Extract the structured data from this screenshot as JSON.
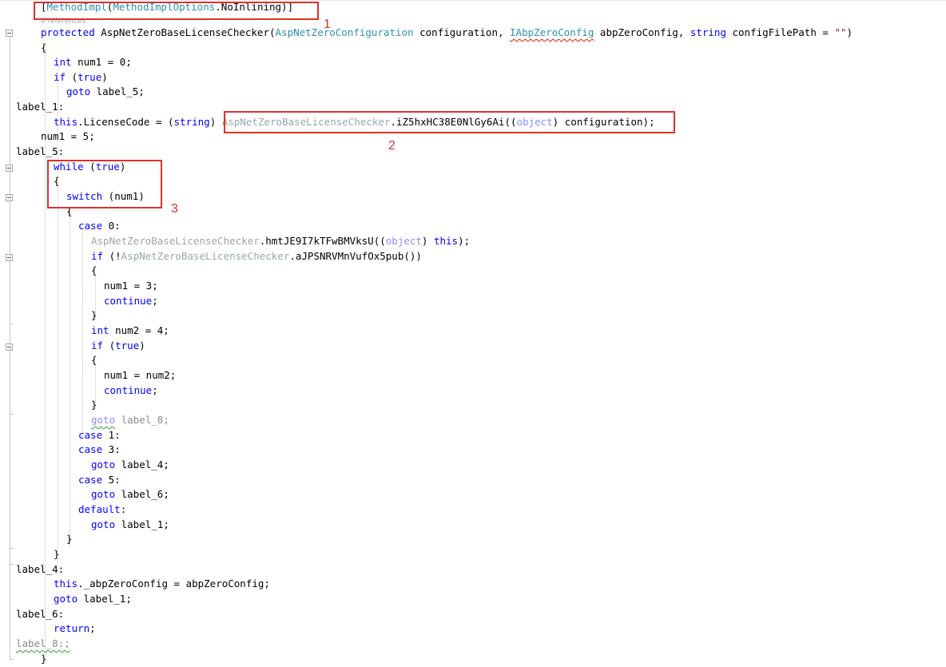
{
  "codelens": "0 references",
  "lines": [
    {
      "tokens": [
        {
          "t": "[",
          "c": ""
        },
        {
          "t": "MethodImpl",
          "c": "ty"
        },
        {
          "t": "(",
          "c": ""
        },
        {
          "t": "MethodImplOptions",
          "c": "ty"
        },
        {
          "t": ".NoInlining)]",
          "c": ""
        }
      ]
    },
    {
      "tokens": [
        {
          "t": "protected ",
          "c": "kw"
        },
        {
          "t": "AspNetZeroBaseLicenseChecker(",
          "c": ""
        },
        {
          "t": "AspNetZeroConfiguration",
          "c": "ty"
        },
        {
          "t": " configuration, ",
          "c": ""
        },
        {
          "t": "IAbpZeroConfig",
          "c": "ty squig sq-red"
        },
        {
          "t": " abpZeroConfig, ",
          "c": ""
        },
        {
          "t": "string",
          "c": "kw"
        },
        {
          "t": " configFilePath = ",
          "c": ""
        },
        {
          "t": "\"\"",
          "c": "str"
        },
        {
          "t": ")",
          "c": ""
        }
      ]
    },
    {
      "tokens": [
        {
          "t": "{",
          "c": ""
        }
      ]
    },
    {
      "tokens": [
        {
          "t": "int",
          "c": "kw"
        },
        {
          "t": " num1 = 0;",
          "c": ""
        }
      ]
    },
    {
      "tokens": [
        {
          "t": "if",
          "c": "kw"
        },
        {
          "t": " (",
          "c": ""
        },
        {
          "t": "true",
          "c": "kw"
        },
        {
          "t": ")",
          "c": ""
        }
      ]
    },
    {
      "tokens": [
        {
          "t": "goto",
          "c": "kw"
        },
        {
          "t": " label_5;",
          "c": ""
        }
      ]
    },
    {
      "tokens": [
        {
          "t": "label_1:",
          "c": ""
        }
      ]
    },
    {
      "tokens": [
        {
          "t": "this",
          "c": "kw"
        },
        {
          "t": ".LicenseCode = (",
          "c": ""
        },
        {
          "t": "string",
          "c": "kw"
        },
        {
          "t": ") ",
          "c": ""
        },
        {
          "t": "AspNetZeroBaseLicenseChecker",
          "c": "fade"
        },
        {
          "t": ".iZ5hxHC38E0NlGy6Ai((",
          "c": ""
        },
        {
          "t": "object",
          "c": "fadekw"
        },
        {
          "t": ") configuration);",
          "c": ""
        }
      ]
    },
    {
      "tokens": [
        {
          "t": "num1 = 5;",
          "c": ""
        }
      ]
    },
    {
      "tokens": [
        {
          "t": "label_5:",
          "c": ""
        }
      ]
    },
    {
      "tokens": [
        {
          "t": "while",
          "c": "kw"
        },
        {
          "t": " (",
          "c": ""
        },
        {
          "t": "true",
          "c": "kw"
        },
        {
          "t": ")",
          "c": ""
        }
      ]
    },
    {
      "tokens": [
        {
          "t": "{",
          "c": ""
        }
      ]
    },
    {
      "tokens": [
        {
          "t": "switch",
          "c": "kw"
        },
        {
          "t": " (num1)",
          "c": ""
        }
      ]
    },
    {
      "tokens": [
        {
          "t": "{",
          "c": ""
        }
      ]
    },
    {
      "tokens": [
        {
          "t": "case",
          "c": "kw"
        },
        {
          "t": " 0:",
          "c": ""
        }
      ]
    },
    {
      "tokens": [
        {
          "t": "AspNetZeroBaseLicenseChecker",
          "c": "fade"
        },
        {
          "t": ".hmtJE9I7kTFwBMVksU((",
          "c": ""
        },
        {
          "t": "object",
          "c": "fadekw"
        },
        {
          "t": ") ",
          "c": ""
        },
        {
          "t": "this",
          "c": "kw"
        },
        {
          "t": ");",
          "c": ""
        }
      ]
    },
    {
      "tokens": [
        {
          "t": "if",
          "c": "kw"
        },
        {
          "t": " (!",
          "c": ""
        },
        {
          "t": "AspNetZeroBaseLicenseChecker",
          "c": "fade"
        },
        {
          "t": ".aJPSNRVMnVufOx5pub())",
          "c": ""
        }
      ]
    },
    {
      "tokens": [
        {
          "t": "{",
          "c": ""
        }
      ]
    },
    {
      "tokens": [
        {
          "t": "num1 = 3;",
          "c": ""
        }
      ]
    },
    {
      "tokens": [
        {
          "t": "continue",
          "c": "kw"
        },
        {
          "t": ";",
          "c": ""
        }
      ]
    },
    {
      "tokens": [
        {
          "t": "}",
          "c": ""
        }
      ]
    },
    {
      "tokens": [
        {
          "t": "int",
          "c": "kw"
        },
        {
          "t": " num2 = 4;",
          "c": ""
        }
      ]
    },
    {
      "tokens": [
        {
          "t": "if",
          "c": "kw"
        },
        {
          "t": " (",
          "c": ""
        },
        {
          "t": "true",
          "c": "kw"
        },
        {
          "t": ")",
          "c": ""
        }
      ]
    },
    {
      "tokens": [
        {
          "t": "{",
          "c": ""
        }
      ]
    },
    {
      "tokens": [
        {
          "t": "num1 = num2;",
          "c": ""
        }
      ]
    },
    {
      "tokens": [
        {
          "t": "continue",
          "c": "kw"
        },
        {
          "t": ";",
          "c": ""
        }
      ]
    },
    {
      "tokens": [
        {
          "t": "}",
          "c": ""
        }
      ]
    },
    {
      "tokens": [
        {
          "t": "goto",
          "c": "fadekw squig sq-green"
        },
        {
          "t": " label_8;",
          "c": "gray"
        }
      ]
    },
    {
      "tokens": [
        {
          "t": "case",
          "c": "kw"
        },
        {
          "t": " 1:",
          "c": ""
        }
      ]
    },
    {
      "tokens": [
        {
          "t": "case",
          "c": "kw"
        },
        {
          "t": " 3:",
          "c": ""
        }
      ]
    },
    {
      "tokens": [
        {
          "t": "goto",
          "c": "kw"
        },
        {
          "t": " label_4;",
          "c": ""
        }
      ]
    },
    {
      "tokens": [
        {
          "t": "case",
          "c": "kw"
        },
        {
          "t": " 5:",
          "c": ""
        }
      ]
    },
    {
      "tokens": [
        {
          "t": "goto",
          "c": "kw"
        },
        {
          "t": " label_6;",
          "c": ""
        }
      ]
    },
    {
      "tokens": [
        {
          "t": "default",
          "c": "kw"
        },
        {
          "t": ":",
          "c": ""
        }
      ]
    },
    {
      "tokens": [
        {
          "t": "goto",
          "c": "kw"
        },
        {
          "t": " label_1;",
          "c": ""
        }
      ]
    },
    {
      "tokens": [
        {
          "t": "}",
          "c": ""
        }
      ]
    },
    {
      "tokens": [
        {
          "t": "}",
          "c": ""
        }
      ]
    },
    {
      "tokens": [
        {
          "t": "label_4:",
          "c": ""
        }
      ]
    },
    {
      "tokens": [
        {
          "t": "this",
          "c": "kw"
        },
        {
          "t": "._abpZeroConfig = abpZeroConfig;",
          "c": ""
        }
      ]
    },
    {
      "tokens": [
        {
          "t": "goto",
          "c": "kw"
        },
        {
          "t": " label_1;",
          "c": ""
        }
      ]
    },
    {
      "tokens": [
        {
          "t": "label_6:",
          "c": ""
        }
      ]
    },
    {
      "tokens": [
        {
          "t": "return",
          "c": "kw"
        },
        {
          "t": ";",
          "c": ""
        }
      ]
    },
    {
      "tokens": [
        {
          "t": "label_8:;",
          "c": "gray squig sq-green"
        }
      ]
    },
    {
      "tokens": [
        {
          "t": "}",
          "c": ""
        }
      ]
    }
  ],
  "annotations": [
    {
      "label": "1"
    },
    {
      "label": "2"
    },
    {
      "label": "3"
    }
  ]
}
